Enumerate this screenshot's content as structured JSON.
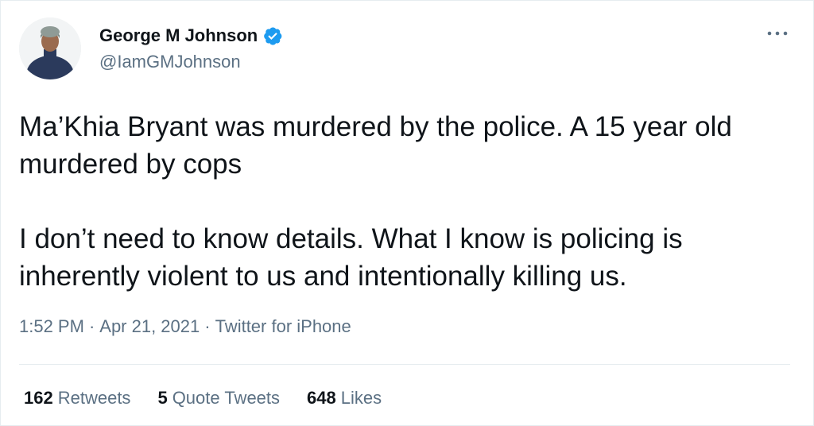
{
  "author": {
    "display_name": "George M Johnson",
    "handle": "@IamGMJohnson",
    "verified_icon": "verified-badge-icon",
    "avatar_icon": "avatar-person-photo"
  },
  "menu": {
    "icon": "more-options-icon"
  },
  "tweet": {
    "paragraphs": [
      "Ma’Khia Bryant was murdered by the police. A 15 year old murdered by cops",
      "I don’t need to know details. What I know is policing is inherently violent to us and intentionally killing us."
    ],
    "time": "1:52 PM",
    "date": "Apr 21, 2021",
    "source": "Twitter for iPhone",
    "separator": "·"
  },
  "stats": {
    "retweets": {
      "count": "162",
      "label": "Retweets"
    },
    "quote_tweets": {
      "count": "5",
      "label": "Quote Tweets"
    },
    "likes": {
      "count": "648",
      "label": "Likes"
    }
  },
  "colors": {
    "text": "#0f1419",
    "secondary": "#5b7083",
    "verified": "#1d9bf0",
    "divider": "#e6ecf0"
  }
}
